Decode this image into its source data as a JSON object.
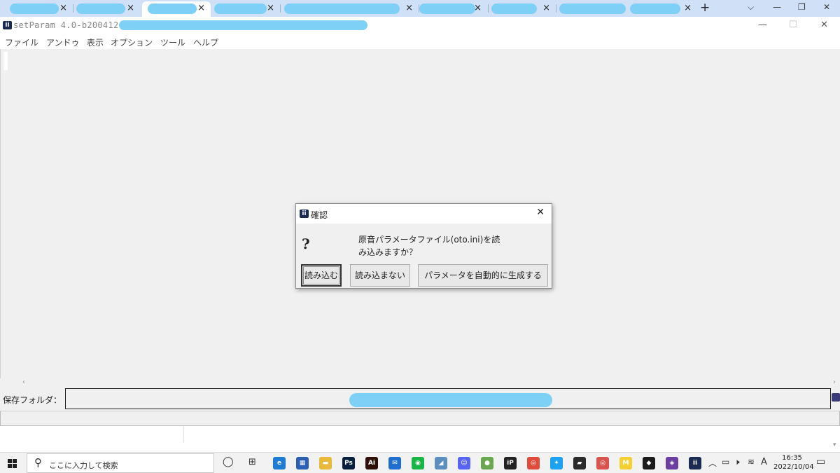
{
  "browser": {
    "tabs": [
      {
        "close_glyph": "×"
      },
      {
        "close_glyph": "×"
      },
      {
        "close_glyph": "×"
      },
      {
        "close_glyph": "×"
      },
      {
        "close_glyph": "×"
      },
      {
        "close_glyph": "×"
      },
      {
        "close_glyph": "×"
      },
      {
        "close_glyph": "×"
      },
      {
        "close_glyph": "×"
      },
      {
        "close_glyph": "×"
      }
    ],
    "new_tab_glyph": "+",
    "chevron_glyph": "⌵",
    "minimize_glyph": "—",
    "restore_glyph": "❐",
    "close_glyph": "✕"
  },
  "app": {
    "icon_text": "ii",
    "title": "setParam 4.0-b200412 -",
    "minimize_glyph": "—",
    "maximize_glyph": "☐",
    "close_glyph": "✕",
    "menu": [
      "ファイル",
      "アンドゥ",
      "表示",
      "オプション",
      "ツール",
      "ヘルプ"
    ],
    "scroll_left_glyph": "‹",
    "scroll_right_glyph": "›",
    "folder_label": "保存フォルダ：",
    "scroll_down_glyph": "▾"
  },
  "dialog": {
    "title": "確認",
    "close_glyph": "✕",
    "question_glyph": "?",
    "message_line1": "原音パラメータファイル(oto.ini)を読",
    "message_line2": "み込みますか？",
    "buttons": {
      "load": "読み込む",
      "dont_load": "読み込まない",
      "auto_generate": "パラメータを自動的に生成する"
    }
  },
  "taskbar": {
    "search_placeholder": "ここに入力して検索",
    "search_glyph": "⚲",
    "taskview_glyph": "◯",
    "apps": [
      {
        "name": "edge",
        "color": "#1f7bd6",
        "label": "e"
      },
      {
        "name": "store",
        "color": "#2b5fb3",
        "label": "▦"
      },
      {
        "name": "explorer",
        "color": "#e8b93a",
        "label": "▬"
      },
      {
        "name": "photoshop",
        "color": "#0a1f3d",
        "label": "Ps"
      },
      {
        "name": "illustrator",
        "color": "#2e0f08",
        "label": "Ai"
      },
      {
        "name": "mail",
        "color": "#1f6fd1",
        "label": "✉"
      },
      {
        "name": "line",
        "color": "#19b548",
        "label": "◉"
      },
      {
        "name": "app-blue",
        "color": "#5b8fc0",
        "label": "◢"
      },
      {
        "name": "discord",
        "color": "#5865f2",
        "label": "☺"
      },
      {
        "name": "app-multi",
        "color": "#6aa84f",
        "label": "●"
      },
      {
        "name": "clip-studio",
        "color": "#222222",
        "label": "iP"
      },
      {
        "name": "chrome",
        "color": "#e04b3a",
        "label": "◎"
      },
      {
        "name": "twitter",
        "color": "#1da1f2",
        "label": "✦"
      },
      {
        "name": "sticky-notes",
        "color": "#2b2b2b",
        "label": "▰"
      },
      {
        "name": "chrome-profile",
        "color": "#d9534f",
        "label": "◎"
      },
      {
        "name": "miro",
        "color": "#f5d033",
        "label": "M"
      },
      {
        "name": "app-dark",
        "color": "#1b1b1b",
        "label": "◆"
      },
      {
        "name": "visual-studio",
        "color": "#6b3fa0",
        "label": "◈"
      },
      {
        "name": "setparam",
        "color": "#1b2a52",
        "label": "ii"
      }
    ],
    "tray": {
      "chevron": "︿",
      "battery": "▭",
      "volume": "🕨",
      "network": "≋",
      "ime": "A"
    },
    "time": "16:35",
    "date": "2022/10/04",
    "notifications_glyph": "▭"
  }
}
